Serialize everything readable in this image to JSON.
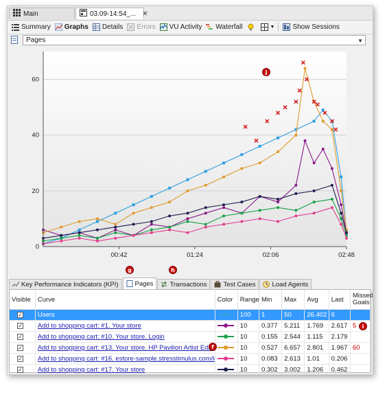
{
  "doc_tabs": [
    {
      "label": "Main",
      "icon": "grid-icon"
    },
    {
      "label": "03.09-14:54_...",
      "icon": "test-result-icon"
    }
  ],
  "toolbar": [
    {
      "label": "Summary",
      "icon": "summary-icon",
      "bold": false,
      "disabled": false
    },
    {
      "label": "Graphs",
      "icon": "graphs-icon",
      "bold": true,
      "disabled": false
    },
    {
      "label": "Details",
      "icon": "details-icon",
      "bold": false,
      "disabled": false
    },
    {
      "label": "Errors",
      "icon": "errors-icon",
      "bold": false,
      "disabled": true
    },
    {
      "label": "VU Activity",
      "icon": "vu-activity-icon",
      "bold": false,
      "disabled": false
    },
    {
      "label": "Waterfall",
      "icon": "waterfall-icon",
      "bold": false,
      "disabled": false
    },
    {
      "label": "Show Sessions",
      "icon": "sessions-icon",
      "bold": false,
      "disabled": false
    }
  ],
  "graph_select": {
    "value": "Pages"
  },
  "chart_data": {
    "type": "line",
    "x_ticks": [
      "00:42",
      "01:24",
      "02:06",
      "02:48"
    ],
    "y_ticks": [
      "0",
      "20",
      "40",
      "60"
    ],
    "ylim": [
      0,
      70
    ],
    "x_range_seconds": [
      0,
      168
    ],
    "series": [
      {
        "name": "Users",
        "color": "#2f9fe0",
        "marker": "square",
        "x": [
          0,
          10,
          20,
          30,
          40,
          50,
          60,
          70,
          80,
          90,
          100,
          110,
          120,
          130,
          140,
          150,
          155,
          160,
          165,
          168
        ],
        "y": [
          1,
          3,
          6,
          9,
          12,
          15,
          18,
          21,
          24,
          27,
          30,
          33,
          36,
          39,
          42,
          45,
          49,
          45,
          25,
          5
        ]
      },
      {
        "name": "Add to shopping cart: #1. Your store",
        "color": "#8b1a8b",
        "marker": "dot",
        "x": [
          0,
          10,
          20,
          30,
          40,
          50,
          60,
          70,
          80,
          90,
          100,
          110,
          120,
          130,
          140,
          145,
          150,
          155,
          160,
          165,
          168
        ],
        "y": [
          6,
          4,
          5,
          3,
          6,
          4,
          8,
          7,
          10,
          12,
          14,
          12,
          18,
          16,
          22,
          38,
          30,
          35,
          28,
          15,
          5
        ]
      },
      {
        "name": "Add to shopping cart: #10. Your store. Login",
        "color": "#19a04a",
        "marker": "dot",
        "x": [
          0,
          10,
          20,
          30,
          40,
          50,
          60,
          70,
          80,
          90,
          100,
          110,
          120,
          130,
          140,
          150,
          160,
          165,
          168
        ],
        "y": [
          2,
          3,
          4,
          3,
          5,
          4,
          6,
          7,
          9,
          8,
          11,
          12,
          13,
          14,
          13,
          16,
          17,
          10,
          4
        ]
      },
      {
        "name": "Add to shopping cart: #13. Your store. HP Pavilion Artist Edition",
        "color": "#e09a2a",
        "marker": "dot",
        "x": [
          0,
          10,
          20,
          30,
          40,
          50,
          60,
          70,
          80,
          90,
          100,
          110,
          120,
          130,
          140,
          145,
          150,
          155,
          160,
          165,
          168
        ],
        "y": [
          5,
          7,
          9,
          10,
          8,
          12,
          14,
          16,
          20,
          22,
          25,
          28,
          30,
          34,
          40,
          64,
          52,
          45,
          42,
          20,
          6
        ]
      },
      {
        "name": "Add to shopping cart: #16. estore-sample.stressstimulus.com/logo",
        "color": "#e23c8f",
        "marker": "dot",
        "x": [
          0,
          10,
          20,
          30,
          40,
          50,
          60,
          70,
          80,
          90,
          100,
          110,
          120,
          130,
          140,
          150,
          160,
          165,
          168
        ],
        "y": [
          1,
          2,
          3,
          2,
          3,
          4,
          5,
          6,
          5,
          7,
          8,
          9,
          10,
          9,
          11,
          12,
          14,
          8,
          3
        ]
      },
      {
        "name": "Add to shopping cart: #17. Your store",
        "color": "#1e1e50",
        "marker": "dot",
        "x": [
          0,
          10,
          20,
          30,
          40,
          50,
          60,
          70,
          80,
          90,
          100,
          110,
          120,
          130,
          140,
          150,
          160,
          165,
          168
        ],
        "y": [
          3,
          4,
          5,
          6,
          7,
          8,
          9,
          11,
          12,
          14,
          15,
          16,
          18,
          17,
          19,
          20,
          22,
          12,
          5
        ]
      }
    ],
    "missed_goal_markers": {
      "color": "#d42222",
      "marker": "x",
      "x": [
        112,
        118,
        124,
        130,
        134,
        140,
        142,
        144,
        146,
        150,
        152,
        156,
        160,
        162
      ],
      "y": [
        43,
        38,
        45,
        48,
        50,
        52,
        56,
        66,
        60,
        52,
        51,
        48,
        45,
        42
      ]
    }
  },
  "callouts": [
    "j",
    "g",
    "h",
    "f",
    "i"
  ],
  "bottom_tabs": [
    {
      "label": "Key Performance Indicators (KPI)",
      "icon": "kpi-icon",
      "active": false
    },
    {
      "label": "Pages",
      "icon": "pages-icon",
      "active": true
    },
    {
      "label": "Transactions",
      "icon": "transactions-icon",
      "active": false
    },
    {
      "label": "Test Cases",
      "icon": "test-cases-icon",
      "active": false
    },
    {
      "label": "Load Agents",
      "icon": "load-agents-icon",
      "active": false
    }
  ],
  "table": {
    "headers": [
      "Visible",
      "Curve",
      "Color",
      "Range",
      "Min",
      "Max",
      "Avg",
      "Last",
      "Missed Goals"
    ],
    "rows": [
      {
        "visible": true,
        "curve": "Users",
        "color": "#2f9fe0",
        "range": "100",
        "min": "1",
        "max": "50",
        "avg": "26.402",
        "last": "6",
        "missed": "",
        "selected": true,
        "link": false
      },
      {
        "visible": true,
        "curve": "Add to shopping cart: #1. Your store",
        "color": "#8b1a8b",
        "range": "10",
        "min": "0.377",
        "max": "5.211",
        "avg": "1.769",
        "last": "2.617",
        "missed": "5",
        "selected": false,
        "link": true
      },
      {
        "visible": true,
        "curve": "Add to shopping cart: #10. Your store. Login",
        "color": "#19a04a",
        "range": "10",
        "min": "0.155",
        "max": "2.544",
        "avg": "1.115",
        "last": "2.179",
        "missed": "",
        "selected": false,
        "link": true
      },
      {
        "visible": true,
        "curve": "Add to shopping cart: #13. Your store. HP Pavilion Artist Editi",
        "color": "#e09a2a",
        "range": "10",
        "min": "0.527",
        "max": "6.657",
        "avg": "2.801",
        "last": "1.967",
        "missed": "60",
        "selected": false,
        "link": true
      },
      {
        "visible": true,
        "curve": "Add to shopping cart: #16. estore-sample.stresstimulus.com/logo",
        "color": "#e23c8f",
        "range": "10",
        "min": "0.083",
        "max": "2.613",
        "avg": "1.01",
        "last": "0.206",
        "missed": "",
        "selected": false,
        "link": true
      },
      {
        "visible": true,
        "curve": "Add to shopping cart: #17. Your store",
        "color": "#1e1e50",
        "range": "10",
        "min": "0.302",
        "max": "3.002",
        "avg": "1.206",
        "last": "0.462",
        "missed": "",
        "selected": false,
        "link": true
      }
    ]
  }
}
